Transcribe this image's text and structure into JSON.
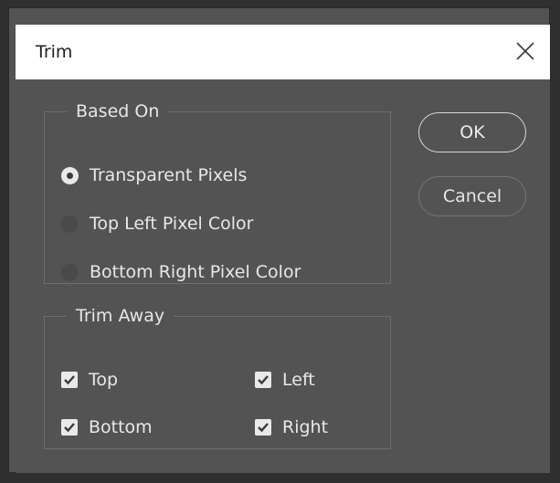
{
  "dialog": {
    "title": "Trim"
  },
  "based_on": {
    "legend": "Based On",
    "options": [
      {
        "label": "Transparent Pixels",
        "selected": true
      },
      {
        "label": "Top Left Pixel Color",
        "selected": false
      },
      {
        "label": "Bottom Right Pixel Color",
        "selected": false
      }
    ]
  },
  "trim_away": {
    "legend": "Trim Away",
    "checkboxes": [
      {
        "label": "Top",
        "checked": true
      },
      {
        "label": "Left",
        "checked": true
      },
      {
        "label": "Bottom",
        "checked": true
      },
      {
        "label": "Right",
        "checked": true
      }
    ]
  },
  "buttons": {
    "ok_label": "OK",
    "cancel_label": "Cancel"
  },
  "icons": {
    "close": "close-icon",
    "checkmark": "checkmark-icon"
  },
  "colors": {
    "panel_bg": "#535353",
    "title_bg": "#ffffff",
    "text": "#e8e8e8"
  }
}
